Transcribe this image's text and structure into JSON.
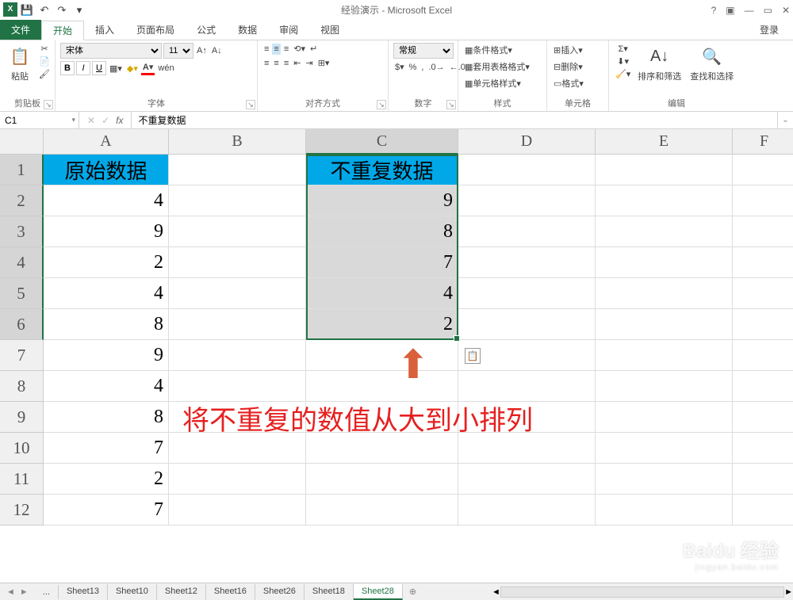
{
  "app": {
    "title": "经验演示 - Microsoft Excel",
    "excel_mark": "X"
  },
  "qat": {
    "save": "💾",
    "undo": "↶",
    "redo": "↷"
  },
  "win": {
    "help": "?",
    "ribbon": "▣",
    "min": "—",
    "restore": "▭",
    "close": "✕"
  },
  "tabs": {
    "file": "文件",
    "home": "开始",
    "insert": "插入",
    "layout": "页面布局",
    "formulas": "公式",
    "data": "数据",
    "review": "审阅",
    "view": "视图",
    "login": "登录"
  },
  "ribbon": {
    "clipboard": {
      "label": "剪贴板",
      "paste": "粘贴"
    },
    "font": {
      "label": "字体",
      "name": "宋体",
      "size": "11",
      "wen": "wén"
    },
    "align": {
      "label": "对齐方式"
    },
    "number": {
      "label": "数字",
      "general": "常规"
    },
    "styles": {
      "label": "样式",
      "cond": "条件格式",
      "table": "套用表格格式",
      "cell": "单元格样式"
    },
    "cells": {
      "label": "单元格",
      "insert": "插入",
      "delete": "删除",
      "format": "格式"
    },
    "editing": {
      "label": "编辑",
      "sort": "排序和筛选",
      "find": "查找和选择"
    }
  },
  "formula_bar": {
    "cell_ref": "C1",
    "fx": "fx",
    "value": "不重复数据"
  },
  "columns": [
    "A",
    "B",
    "C",
    "D",
    "E",
    "F"
  ],
  "rows": [
    "1",
    "2",
    "3",
    "4",
    "5",
    "6",
    "7",
    "8",
    "9",
    "10",
    "11",
    "12"
  ],
  "data": {
    "A_header": "原始数据",
    "C_header": "不重复数据",
    "A": [
      "4",
      "9",
      "2",
      "4",
      "8",
      "9",
      "4",
      "8",
      "7",
      "2",
      "7"
    ],
    "C": [
      "9",
      "8",
      "7",
      "4",
      "2"
    ]
  },
  "annotation": {
    "arrow": "⬆",
    "text": "将不重复的数值从大到小排列",
    "paste": "📋"
  },
  "sheets": {
    "nav_prev": "◄",
    "nav_next": "►",
    "ellipsis": "...",
    "tabs": [
      "Sheet13",
      "Sheet10",
      "Sheet12",
      "Sheet16",
      "Sheet26",
      "Sheet18",
      "Sheet28"
    ],
    "active": "Sheet28",
    "add": "⊕"
  },
  "watermark": {
    "line1": "Baidu 经验",
    "line2": "jingyan.baidu.com"
  }
}
